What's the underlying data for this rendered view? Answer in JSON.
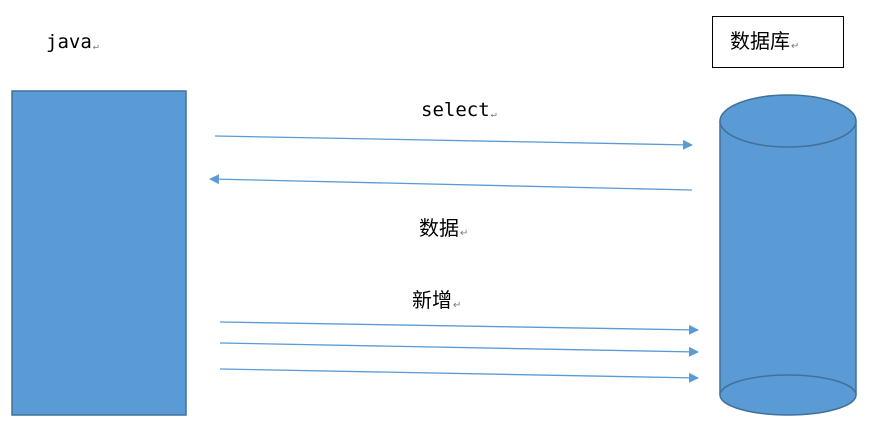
{
  "labels": {
    "java": "java",
    "database": "数据库",
    "select": "select",
    "data": "数据",
    "insert": "新增",
    "paragraph_mark": "↵"
  },
  "colors": {
    "shape_fill": "#5b9bd5",
    "shape_stroke": "#41719c",
    "arrow": "#5b9bd5",
    "text": "#000000"
  },
  "shapes": {
    "java_block": "rectangle",
    "database_block": "cylinder"
  },
  "arrows": [
    {
      "id": "select-arrow",
      "direction": "java-to-database"
    },
    {
      "id": "data-return-arrow",
      "direction": "database-to-java"
    },
    {
      "id": "insert-arrow-1",
      "direction": "java-to-database"
    },
    {
      "id": "insert-arrow-2",
      "direction": "java-to-database"
    },
    {
      "id": "insert-arrow-3",
      "direction": "java-to-database"
    }
  ]
}
